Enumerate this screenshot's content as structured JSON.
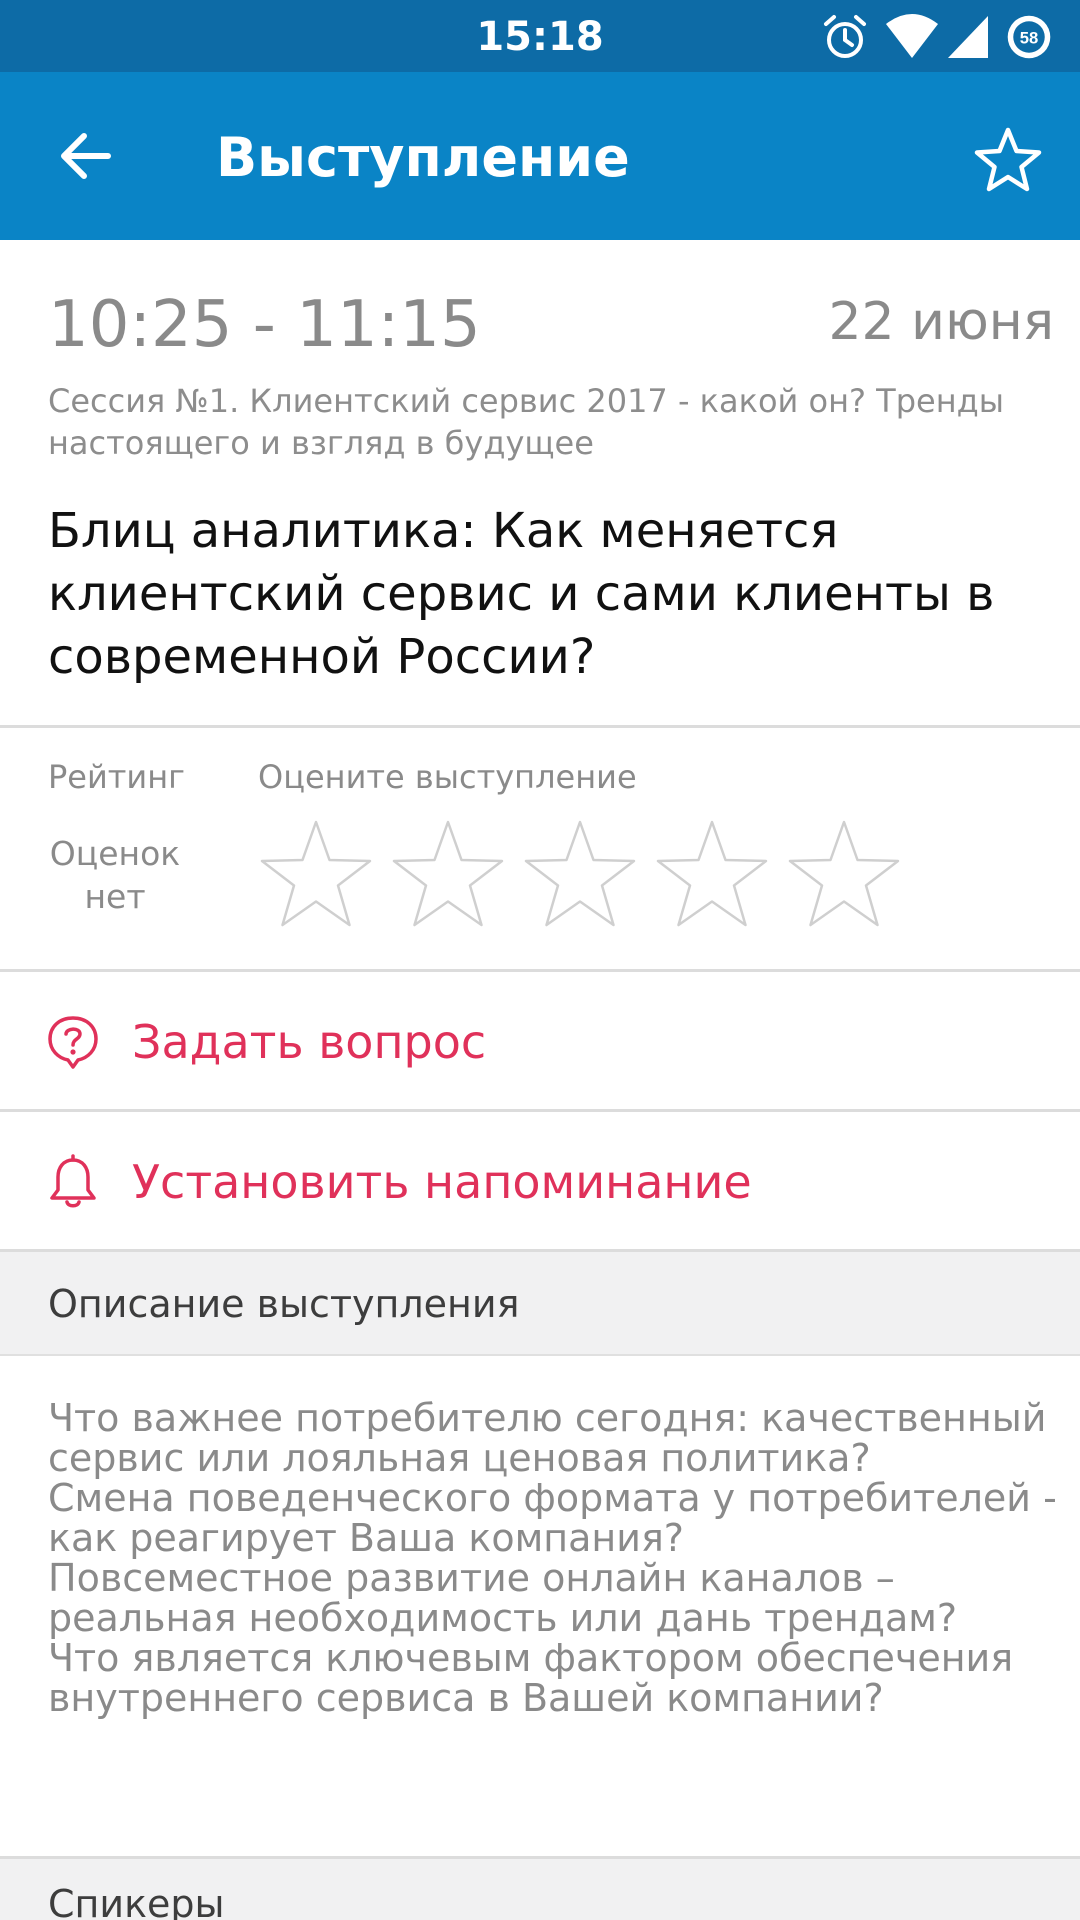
{
  "status_bar": {
    "time": "15:18",
    "battery_level": "58",
    "icons": [
      "alarm-icon",
      "wifi-icon",
      "signal-icon",
      "battery-icon"
    ]
  },
  "app_bar": {
    "title": "Выступление",
    "back_icon": "arrow-left-icon",
    "favorite_icon": "star-outline-icon"
  },
  "talk": {
    "time_range": "10:25 - 11:15",
    "date": "22 июня",
    "session_line1": "Сессия №1. Клиентский сервис 2017 - какой он? Тренды",
    "session_line2": "настоящего и взгляд в будущее",
    "title_lines": [
      "Блиц аналитика: Как меняется",
      "клиентский сервис и сами клиенты в",
      "современной России?"
    ]
  },
  "rating": {
    "label": "Рейтинг",
    "rate_prompt": "Оцените выступление",
    "count_line1": "Оценок",
    "count_line2": "нет",
    "stars_total": 5,
    "stars_selected": 0
  },
  "actions": {
    "ask_label": "Задать вопрос",
    "ask_icon": "question-bubble-icon",
    "remind_label": "Установить напоминание",
    "remind_icon": "bell-icon"
  },
  "description": {
    "header": "Описание выступления",
    "lines": [
      "Что важнее потребителю сегодня: качественный",
      "сервис или лояльная ценовая политика?",
      "Смена поведенческого формата у потребителей -",
      "как реагирует Ваша компания?",
      "Повсеместное развитие онлайн каналов –",
      "реальная необходимость или дань трендам?",
      "Что является ключевым фактором обеспечения",
      "внутреннего сервиса в Вашей компании?"
    ]
  },
  "speakers": {
    "header": "Спикеры"
  },
  "colors": {
    "status_bar": "#0d6ba6",
    "app_bar": "#0a84c6",
    "accent": "#e0315a",
    "secondary_text": "#8a8a8a"
  }
}
